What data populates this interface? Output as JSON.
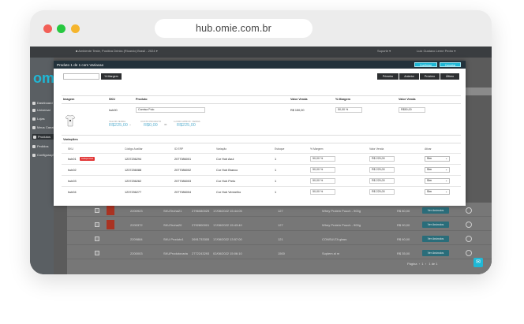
{
  "browser": {
    "url": "hub.omie.com.br"
  },
  "app": {
    "logo": "om",
    "topbar_title": "■ Ambiente Teste, Positiva Drinks (Ricardo) Brasil - 2024 ▾",
    "topbar_right_1": "Suporte ▾",
    "topbar_right_2": "Luiz Gustavo Leme Pedro ▾",
    "nav": [
      "Dashboard",
      "Universal",
      "Lojas",
      "Meus Canais",
      "Produtos",
      "Pedidos",
      "Configurações"
    ],
    "active_nav": "Produtos"
  },
  "modal": {
    "title": "Produto 1 de 1 com Variacao",
    "btn_confirm": "Confirmar",
    "btn_cancel": "Cancelar",
    "margin_button": "% Margem",
    "nav_first": "Primeiro",
    "nav_prev": "Anterior",
    "nav_next": "Próximo",
    "nav_last": "Último",
    "headers": {
      "imagem": "Imagem",
      "sku": "SKU",
      "produto": "Produto",
      "valor_venda": "Valor Venda",
      "margem": "% Margem",
      "valor_venda2": "Valor Venda"
    },
    "product": {
      "sku": "hub00",
      "name": "Camisa Polo",
      "valor_venda": "R$ 150,00",
      "margem": "50,00 %",
      "valor_venda2": "R$50,00"
    },
    "costs": [
      {
        "label": "VALOR VENDA",
        "value": "R$225,00"
      },
      {
        "label": "CUSTO PRODUTO",
        "value": "R$0,00"
      },
      {
        "label": "LUCRO APROX. VENDA",
        "value": "R$225,00"
      }
    ],
    "variations_label": "Variações",
    "var_headers": [
      "SKU",
      "Código Auxiliar",
      "ID ERP",
      "Variação",
      "Estoque",
      "% Margem",
      "Valor Venda",
      "Ativar"
    ],
    "variations": [
      {
        "sku": "hub01",
        "badge": "Indisponível",
        "aux": "1237236294",
        "erp": "2077086001",
        "variacao": "Cor Hub Azul",
        "estoque": "1",
        "margem": "50,00 %",
        "valor": "R$ 225,00",
        "ativar": "Sim"
      },
      {
        "sku": "hub02",
        "badge": "",
        "aux": "1237236088",
        "erp": "2077086002",
        "variacao": "Cor Hub Branco",
        "estoque": "1",
        "margem": "50,00 %",
        "valor": "R$ 225,00",
        "ativar": "Sim"
      },
      {
        "sku": "hub03",
        "badge": "",
        "aux": "1237236262",
        "erp": "2077086003",
        "variacao": "Cor Hub Preto",
        "estoque": "1",
        "margem": "50,00 %",
        "valor": "R$ 225,00",
        "ativar": "Sim"
      },
      {
        "sku": "hub04",
        "badge": "",
        "aux": "1237236277",
        "erp": "2077086004",
        "variacao": "Cor Hub Vermelho",
        "estoque": "1",
        "margem": "50,00 %",
        "valor": "R$ 225,00",
        "ativar": "Sim"
      }
    ]
  },
  "background_rows": [
    {
      "code": "2200923",
      "sku": "SKUTecha21",
      "erp": "2796080025",
      "date": "17/08/2022 15:44:05",
      "stock": "127",
      "desc": "Whey Protein Pouch - 900g",
      "price": "R$ 80,00",
      "price2": "R$ 175,00",
      "btn": "Ver Anúncios"
    },
    {
      "code": "2200372",
      "sku": "SKUTecha20",
      "erp": "2792800001",
      "date": "17/08/2022 15:43:40",
      "stock": "127",
      "desc": "Whey Protein Pouch - 900g",
      "price": "R$ 90,00",
      "price2": "R$ 175,00",
      "btn": "Ver Anúncios"
    },
    {
      "code": "2209884",
      "sku": "SKU Produto1",
      "erp": "2691733305",
      "date": "17/08/2022 13:57:00",
      "stock": "121",
      "desc": "CONSULTA glass",
      "price": "R$ 60,00",
      "price2": "R$ 175,00",
      "btn": "Ver Anúncios"
    },
    {
      "code": "2200003",
      "sku": "SKUProdutovaria",
      "erp": "2772243293",
      "date": "02/08/2022 15:06:10",
      "stock": "1500",
      "desc": "Suplem al m",
      "price": "R$ 35,00",
      "price2": "R$ 175,00",
      "btn": "Ver Anúncios"
    }
  ],
  "pager": {
    "label": "Página",
    "info": "1 de 1"
  }
}
